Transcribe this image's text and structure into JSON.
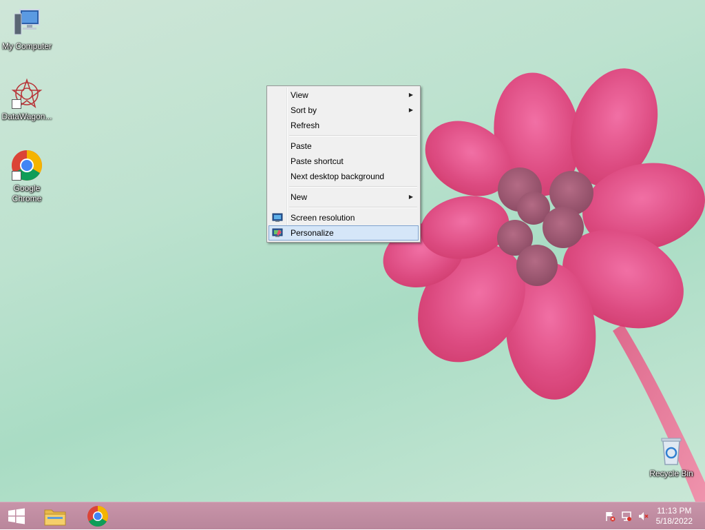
{
  "desktop_icons": [
    {
      "label": "My Computer",
      "icon": "computer-icon"
    },
    {
      "label": "DataWagon...",
      "icon": "datawagon-icon"
    },
    {
      "label": "Google Chrome",
      "icon": "chrome-icon"
    },
    {
      "label": "Recycle Bin",
      "icon": "recycle-bin-icon"
    }
  ],
  "context_menu": {
    "items": [
      {
        "label": "View",
        "submenu": true
      },
      {
        "label": "Sort by",
        "submenu": true
      },
      {
        "label": "Refresh"
      },
      {
        "label": "Paste"
      },
      {
        "label": "Paste shortcut"
      },
      {
        "label": "Next desktop background"
      },
      {
        "label": "New",
        "submenu": true
      },
      {
        "label": "Screen resolution",
        "icon": "monitor-icon"
      },
      {
        "label": "Personalize",
        "icon": "personalize-icon",
        "highlighted": true
      }
    ]
  },
  "taskbar": {
    "buttons": [
      {
        "icon": "windows-start-icon"
      },
      {
        "icon": "file-explorer-icon"
      },
      {
        "icon": "chrome-icon"
      }
    ],
    "tray_icons": [
      "action-center-flag-icon",
      "network-icon",
      "volume-muted-icon"
    ],
    "clock": {
      "time": "11:13 PM",
      "date": "5/18/2022"
    }
  },
  "colors": {
    "taskbar": "#c08ea3",
    "menu_highlight": "#d5e6f8",
    "flower": "#e0457f"
  }
}
